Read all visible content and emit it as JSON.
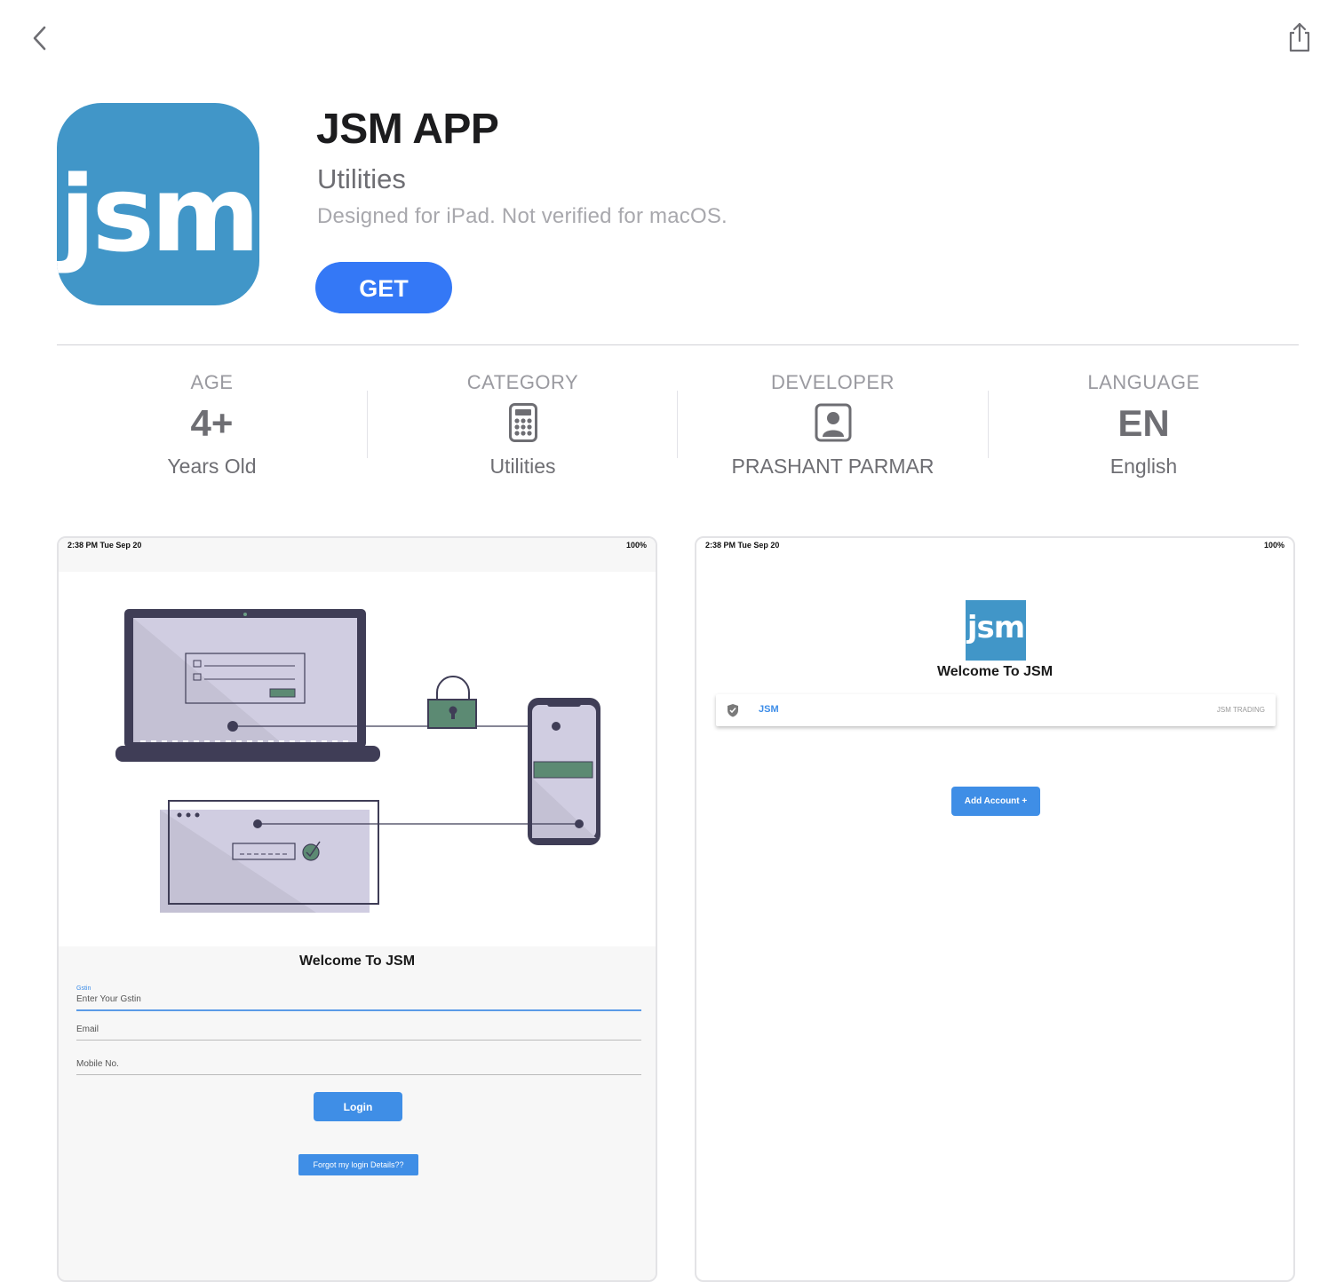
{
  "nav": {
    "back_icon": "chevron-left-icon",
    "share_icon": "share-icon"
  },
  "app": {
    "icon_text": "jsm",
    "title": "JSM APP",
    "category": "Utilities",
    "note": "Designed for iPad. Not verified for macOS.",
    "get_label": "GET",
    "accent": "#3478f6",
    "icon_color": "#4196c8"
  },
  "info": [
    {
      "label": "AGE",
      "value": "4+",
      "sub": "Years Old"
    },
    {
      "label": "CATEGORY",
      "icon": "calculator-icon",
      "sub": "Utilities"
    },
    {
      "label": "DEVELOPER",
      "icon": "person-icon",
      "sub": "PRASHANT PARMAR"
    },
    {
      "label": "LANGUAGE",
      "value": "EN",
      "sub": "English"
    }
  ],
  "screenshots": [
    {
      "status_time": "2:38 PM   Tue Sep 20",
      "status_battery": "100%",
      "welcome": "Welcome To JSM",
      "gstin_label": "Gstin",
      "gstin_placeholder": "Enter Your Gstin",
      "email_label": "Email",
      "mobile_label": "Mobile No.",
      "login_label": "Login",
      "forgot_label": "Forgot my login Details??"
    },
    {
      "status_time": "2:38 PM   Tue Sep 20",
      "status_battery": "100%",
      "logo_text": "jsm",
      "welcome": "Welcome To JSM",
      "account_name": "JSM",
      "account_sub": "JSM TRADING",
      "add_account_label": "Add Account +"
    }
  ]
}
